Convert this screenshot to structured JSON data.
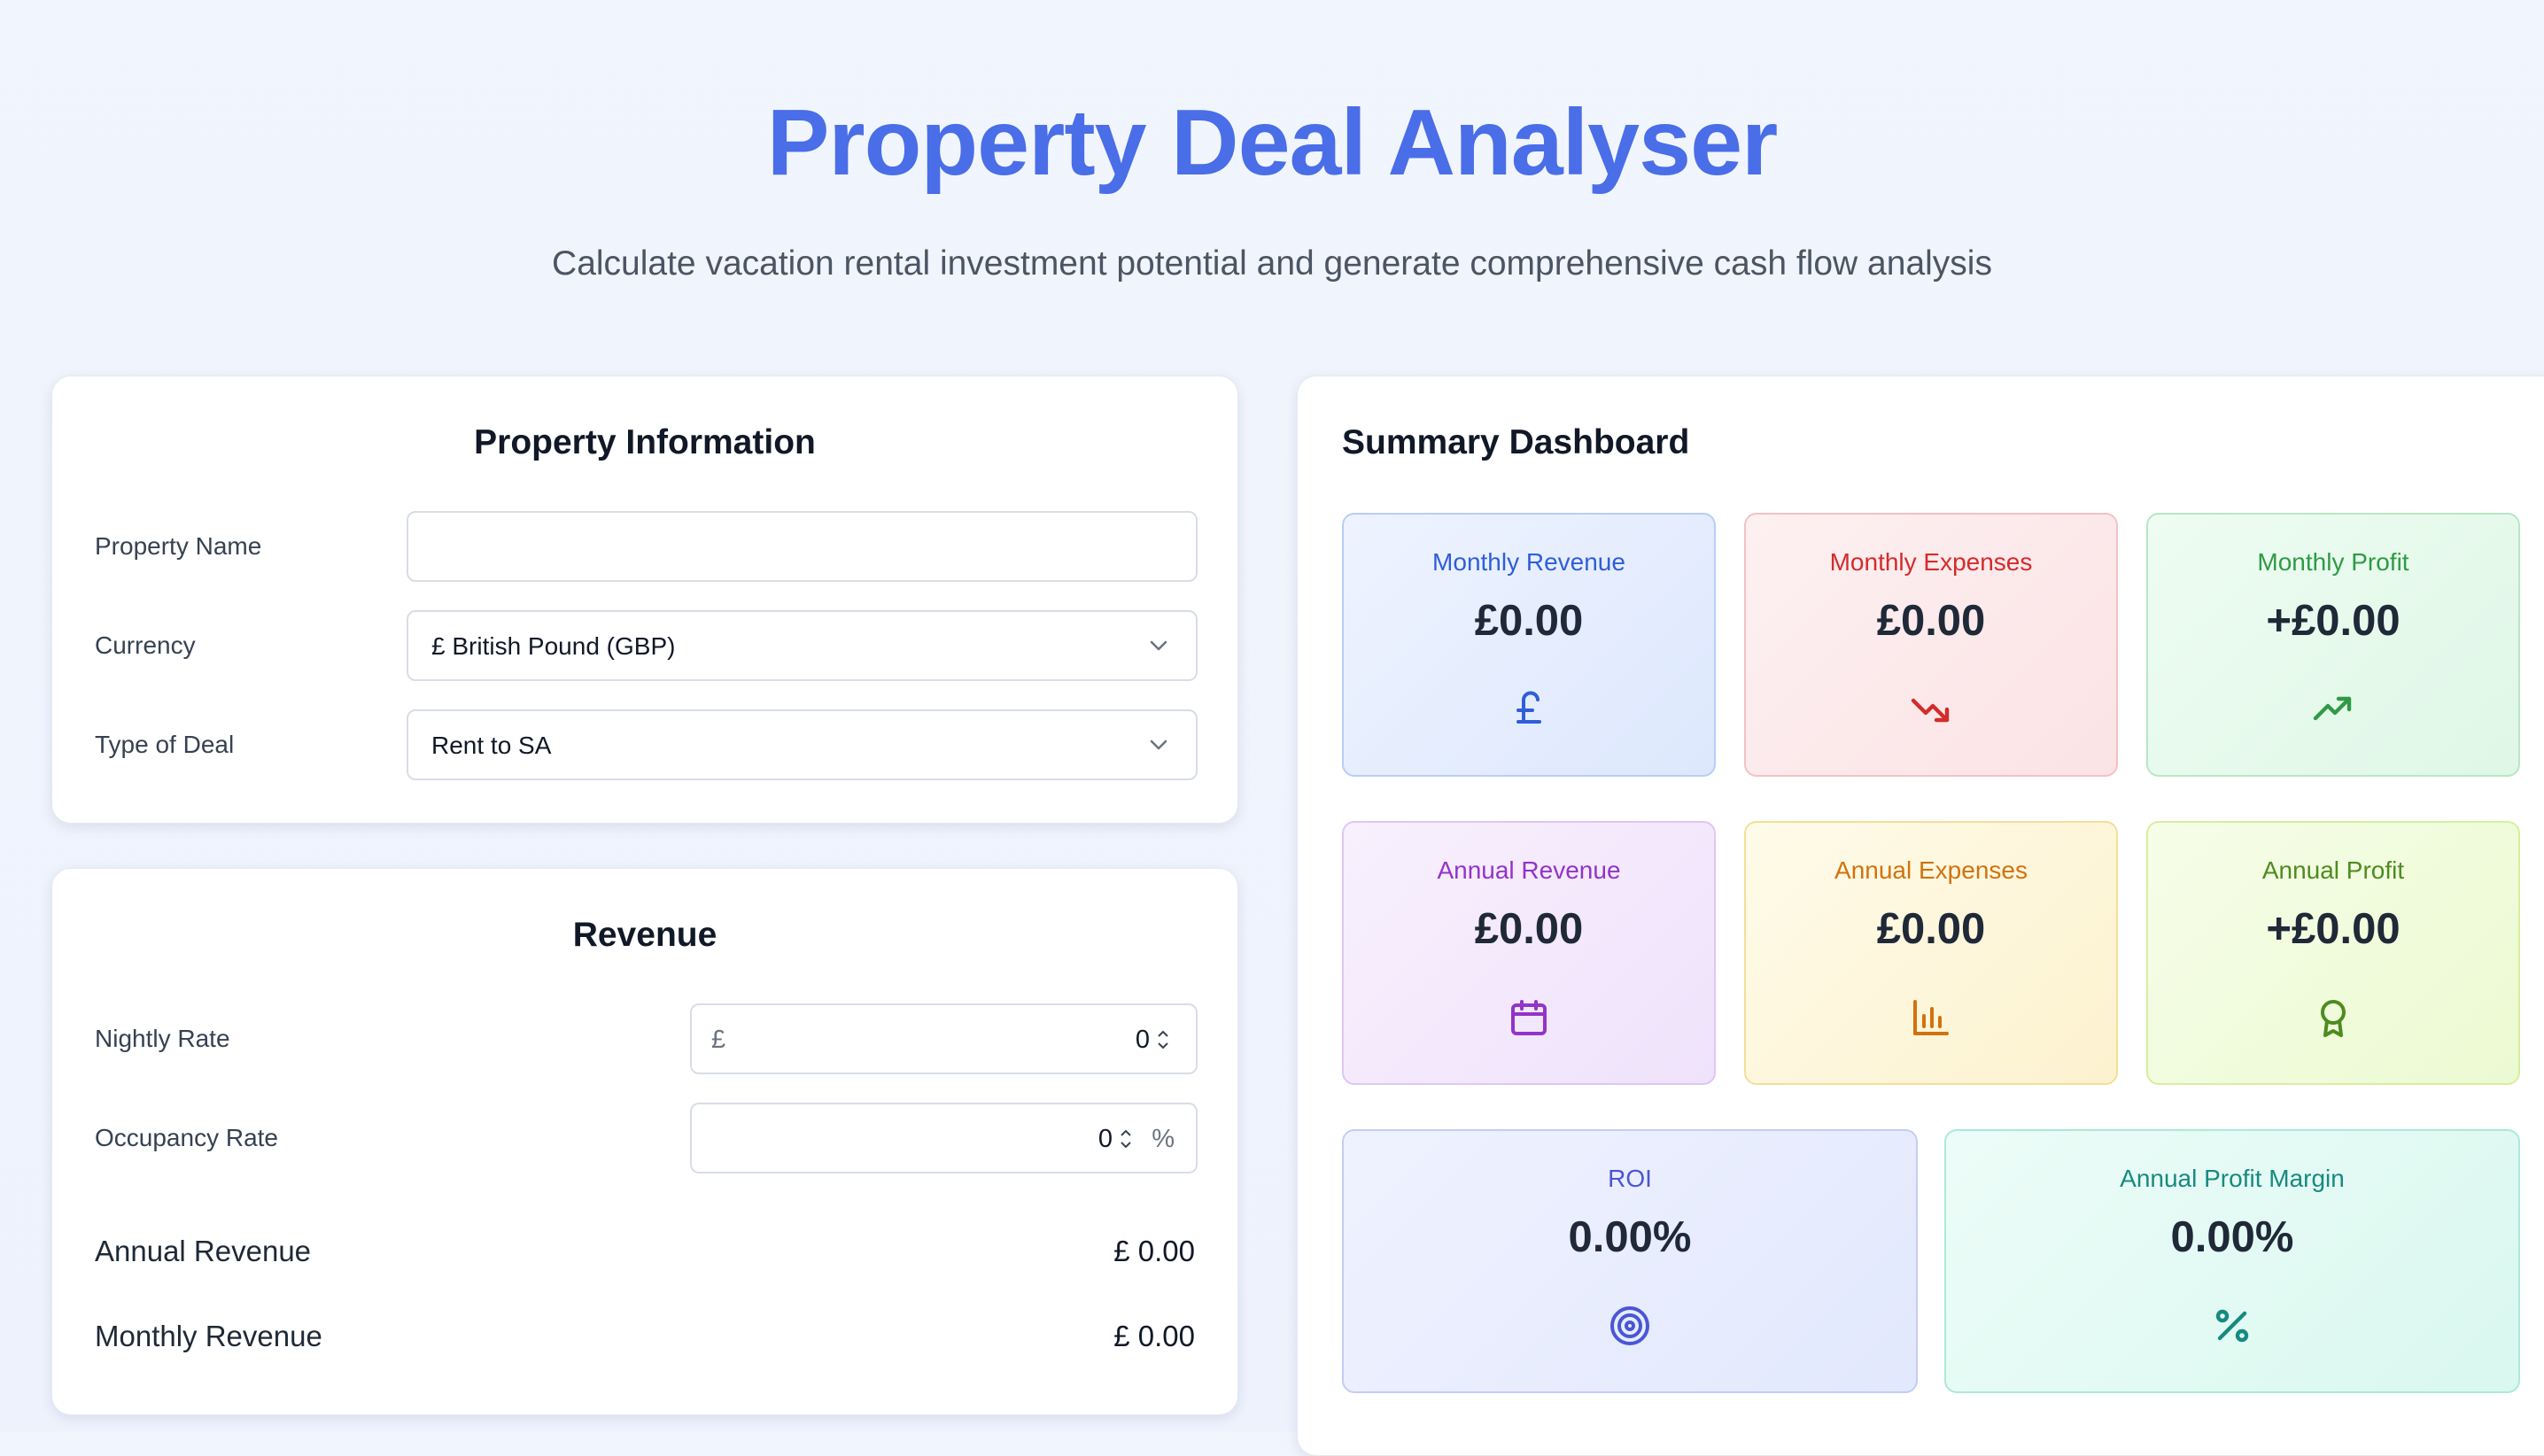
{
  "header": {
    "title": "Property Deal Analyser",
    "subtitle": "Calculate vacation rental investment potential and generate comprehensive cash flow analysis"
  },
  "property_info": {
    "title": "Property Information",
    "property_name_label": "Property Name",
    "property_name_value": "",
    "currency_label": "Currency",
    "currency_value": "£ British Pound (GBP)",
    "deal_type_label": "Type of Deal",
    "deal_type_value": "Rent to SA"
  },
  "revenue": {
    "title": "Revenue",
    "nightly_rate_label": "Nightly Rate",
    "nightly_rate_prefix": "£",
    "nightly_rate_value": "0",
    "occupancy_label": "Occupancy Rate",
    "occupancy_value": "0",
    "occupancy_suffix": "%",
    "annual_revenue_label": "Annual Revenue",
    "annual_revenue_value": "£ 0.00",
    "monthly_revenue_label": "Monthly Revenue",
    "monthly_revenue_value": "£ 0.00"
  },
  "dashboard": {
    "title": "Summary Dashboard",
    "metrics": [
      {
        "label": "Monthly Revenue",
        "value": "£0.00",
        "icon": "pound-icon",
        "accent": "#2f5ed8"
      },
      {
        "label": "Monthly Expenses",
        "value": "£0.00",
        "icon": "trending-down-icon",
        "accent": "#d42b2b"
      },
      {
        "label": "Monthly Profit",
        "value": "+£0.00",
        "icon": "trending-up-icon",
        "accent": "#2f9a46"
      },
      {
        "label": "Annual Revenue",
        "value": "£0.00",
        "icon": "calendar-icon",
        "accent": "#9333c9"
      },
      {
        "label": "Annual Expenses",
        "value": "£0.00",
        "icon": "bar-chart-icon",
        "accent": "#d2720e"
      },
      {
        "label": "Annual Profit",
        "value": "+£0.00",
        "icon": "award-icon",
        "accent": "#4d8c1f"
      },
      {
        "label": "ROI",
        "value": "0.00%",
        "icon": "target-icon",
        "accent": "#4a56d6"
      },
      {
        "label": "Annual Profit Margin",
        "value": "0.00%",
        "icon": "percent-icon",
        "accent": "#178a80"
      }
    ]
  }
}
